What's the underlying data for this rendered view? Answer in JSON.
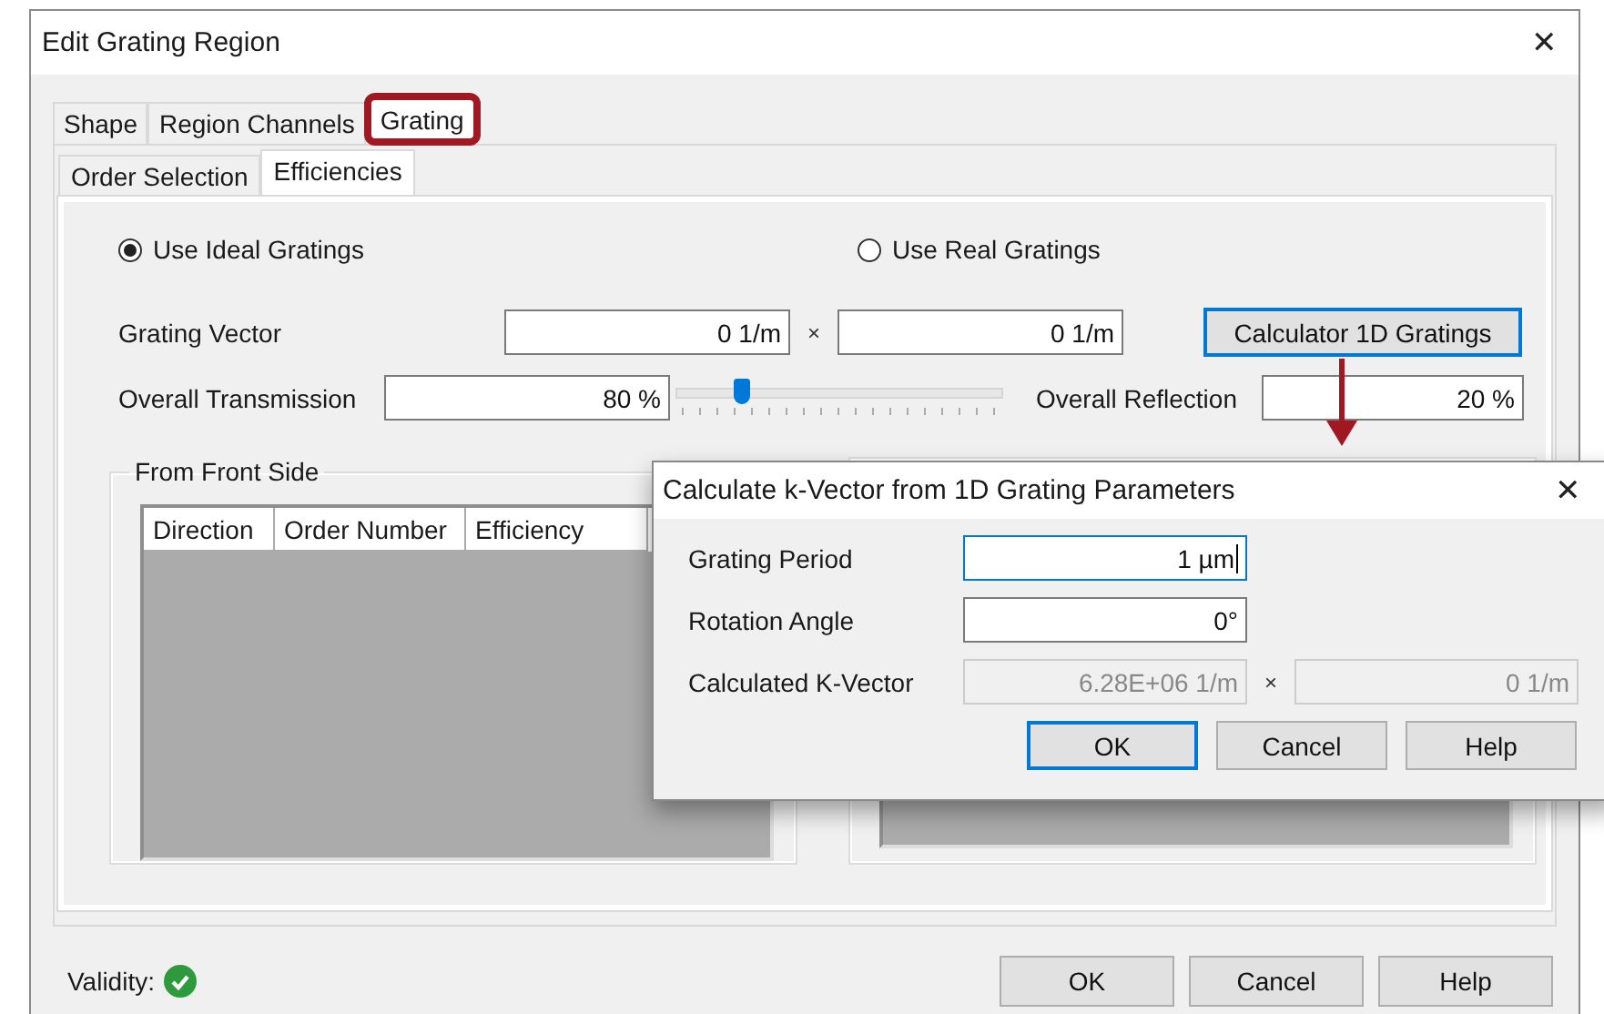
{
  "window": {
    "title": "Edit Grating Region",
    "close": "✕"
  },
  "tabs": [
    {
      "label": "Shape",
      "selected": false,
      "highlighted": false
    },
    {
      "label": "Region Channels",
      "selected": false,
      "highlighted": false
    },
    {
      "label": "Grating",
      "selected": true,
      "highlighted": true
    }
  ],
  "subtabs": [
    {
      "label": "Order Selection",
      "selected": false
    },
    {
      "label": "Efficiencies",
      "selected": true
    }
  ],
  "radios": [
    {
      "label": "Use Ideal Gratings",
      "selected": true
    },
    {
      "label": "Use Real Gratings",
      "selected": false
    }
  ],
  "grating_vector": {
    "label": "Grating Vector",
    "x": "0 1/m",
    "times": "×",
    "y": "0 1/m",
    "button": "Calculator 1D Gratings"
  },
  "transmission": {
    "label": "Overall Transmission",
    "value": "80 %",
    "level": 0.2
  },
  "reflection": {
    "label": "Overall Reflection",
    "value": "20 %"
  },
  "front_side": {
    "title": "From Front Side",
    "columns": [
      "Direction",
      "Order Number",
      "Efficiency"
    ]
  },
  "validity": {
    "label": "Validity:",
    "valid": true
  },
  "buttons": [
    "OK",
    "Cancel",
    "Help"
  ],
  "calc_dialog": {
    "title": "Calculate k-Vector from 1D Grating Parameters",
    "close": "✕",
    "fields": [
      {
        "label": "Grating Period",
        "value": "1 µm",
        "focused": true
      },
      {
        "label": "Rotation Angle",
        "value": "0°",
        "focused": false
      }
    ],
    "result": {
      "label": "Calculated K-Vector",
      "x": "6.28E+06 1/m",
      "times": "×",
      "y": "0 1/m"
    },
    "buttons": [
      {
        "label": "OK",
        "default": true
      },
      {
        "label": "Cancel",
        "default": false
      },
      {
        "label": "Help",
        "default": false
      }
    ]
  }
}
